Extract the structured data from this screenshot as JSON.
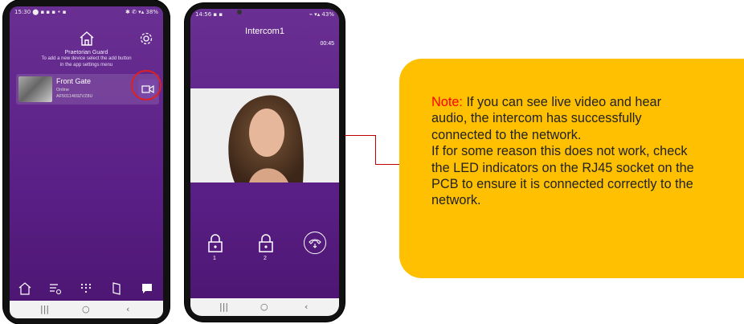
{
  "phone1": {
    "status_left": "15:30 ⬤ ▪ ▪ ▪ • ▪",
    "status_right": "✱ ✆ ▾▴ 38%",
    "brand": "Praetorian Guard",
    "instructions_line1": "To add a new device select the add button",
    "instructions_line2": "in the app settings menu",
    "device": {
      "name": "Front Gate",
      "status": "Online",
      "id": "AF5011469ZVZ8U"
    },
    "highlight_color": "#e02020"
  },
  "phone2": {
    "status_left": "14:56 ▪ ▪",
    "status_right": "⌁ ▾▴ 43%",
    "title": "Intercom1",
    "timer": "00:45",
    "lock1_label": "1",
    "lock2_label": "2"
  },
  "nav": {
    "back": "‹",
    "home": "○",
    "recents": "|||"
  },
  "note": {
    "label": "Note:",
    "line1": " If you can see live video and hear audio, the intercom has successfully connected to the network.",
    "line2": "If for some reason this does not work, check the LED indicators on the RJ45 socket on the PCB to ensure it is connected correctly to the network."
  },
  "colors": {
    "purple": "#5a1f86",
    "note_bg": "#fec000",
    "note_label": "#ff0000",
    "connector": "#c00000"
  }
}
